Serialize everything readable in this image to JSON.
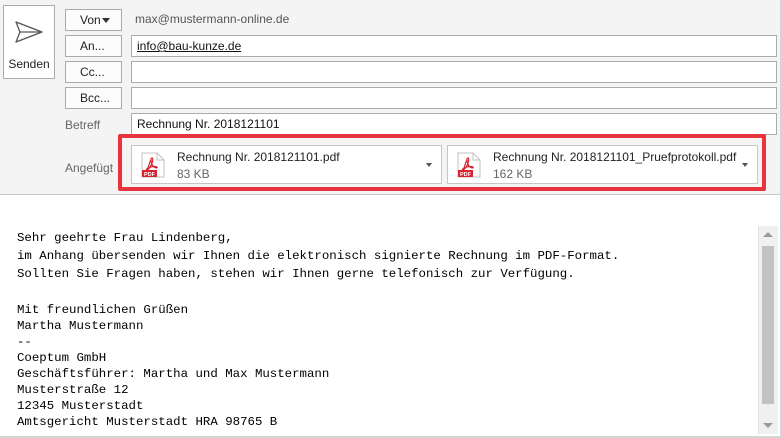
{
  "send": {
    "label": "Senden",
    "icon": "send-icon"
  },
  "from": {
    "button_label": "Von",
    "value": "max@mustermann-online.de"
  },
  "to": {
    "button_label": "An...",
    "value": "info@bau-kunze.de"
  },
  "cc": {
    "button_label": "Cc...",
    "value": ""
  },
  "bcc": {
    "button_label": "Bcc...",
    "value": ""
  },
  "subject": {
    "label": "Betreff",
    "value": "Rechnung Nr. 2018121101"
  },
  "attachments": {
    "label": "Angefügt",
    "items": [
      {
        "name": "Rechnung Nr. 2018121101.pdf",
        "size": "83 KB",
        "icon": "pdf-icon"
      },
      {
        "name": "Rechnung Nr. 2018121101_Pruefprotokoll.pdf",
        "size": "162 KB",
        "icon": "pdf-icon"
      }
    ],
    "highlight_color": "#e8343f"
  },
  "body": {
    "lines": [
      "Sehr geehrte Frau Lindenberg,",
      "im Anhang übersenden wir Ihnen die elektronisch signierte Rechnung im PDF-Format.",
      "Sollten Sie Fragen haben, stehen wir Ihnen gerne telefonisch zur Verfügung.",
      "",
      "Mit freundlichen Grüßen",
      "Martha Mustermann",
      "--",
      "Coeptum GmbH",
      "Geschäftsführer: Martha und Max Mustermann",
      "Musterstraße 12",
      "12345 Musterstadt",
      "Amtsgericht Musterstadt HRA 98765 B"
    ]
  },
  "colors": {
    "pdf_red": "#d9232e",
    "accent": "#e8343f"
  }
}
